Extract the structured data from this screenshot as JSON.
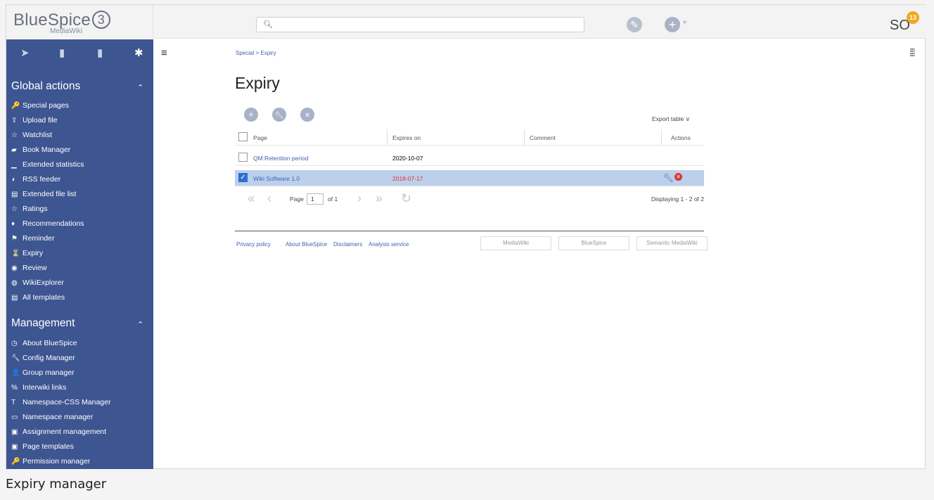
{
  "topbar": {
    "brand": "BlueSpice",
    "brand_version": "3",
    "brand_sub": "MediaWiki",
    "search_icon": "search-icon",
    "edit_icon": "pencil-icon",
    "new_icon": "plus-icon",
    "new_caret": "▾",
    "user_initials": "SO",
    "notif_count": "13"
  },
  "sidebar": {
    "tabs": [
      "navigation-icon",
      "book-icon",
      "clipboard-icon",
      "gear-icon"
    ],
    "global_actions_title": "Global actions",
    "global_actions": [
      {
        "icon": "🔑",
        "label": "Special pages"
      },
      {
        "icon": "⇪",
        "label": "Upload file"
      },
      {
        "icon": "☆",
        "label": "Watchlist"
      },
      {
        "icon": "▰",
        "label": "Book Manager"
      },
      {
        "icon": "▁",
        "label": "Extended statistics"
      },
      {
        "icon": "◗",
        "label": "RSS feeder"
      },
      {
        "icon": "▤",
        "label": "Extended file list"
      },
      {
        "icon": "☆",
        "label": "Ratings"
      },
      {
        "icon": "♦",
        "label": "Recommendations"
      },
      {
        "icon": "⚑",
        "label": "Reminder"
      },
      {
        "icon": "⌛",
        "label": "Expiry"
      },
      {
        "icon": "◉",
        "label": "Review"
      },
      {
        "icon": "◍",
        "label": "WikiExplorer"
      },
      {
        "icon": "▤",
        "label": "All templates"
      }
    ],
    "management_title": "Management",
    "management": [
      {
        "icon": "◷",
        "label": "About BlueSpice"
      },
      {
        "icon": "🔧",
        "label": "Config Manager"
      },
      {
        "icon": "👤",
        "label": "Group manager"
      },
      {
        "icon": "%",
        "label": "Interwiki links"
      },
      {
        "icon": "T",
        "label": "Namespace-CSS Manager"
      },
      {
        "icon": "▭",
        "label": "Namespace manager"
      },
      {
        "icon": "▣",
        "label": "Assignment management"
      },
      {
        "icon": "▣",
        "label": "Page templates"
      },
      {
        "icon": "🔑",
        "label": "Permission manager"
      }
    ]
  },
  "main": {
    "breadcrumb": "Special > Expiry",
    "title": "Expiry",
    "toolbar": {
      "add": "+",
      "edit": "🔧",
      "delete": "✕"
    },
    "export_label": "Export table ∨",
    "columns": [
      "Page",
      "Expires on",
      "Comment",
      "Actions"
    ],
    "rows": [
      {
        "page": "QM:Retention period",
        "expires": "2020-10-07",
        "comment": "",
        "selected": false
      },
      {
        "page": "Wiki Software 1.0",
        "expires": "2018-07-17",
        "comment": "",
        "selected": true
      }
    ],
    "pager": {
      "first": "«",
      "prev": "‹",
      "next": "›",
      "last": "»",
      "refresh": "↻",
      "page_label": "Page",
      "page_value": "1",
      "of_label": "of 1",
      "displaying": "Displaying 1 - 2 of 2"
    },
    "footer": {
      "links": [
        "Privacy policy",
        "About BlueSpice",
        "Disclaimers",
        "Analysis service"
      ],
      "badges": [
        "MediaWiki",
        "BlueSpice",
        "Semantic MediaWiki"
      ]
    }
  },
  "caption": "Expiry manager"
}
